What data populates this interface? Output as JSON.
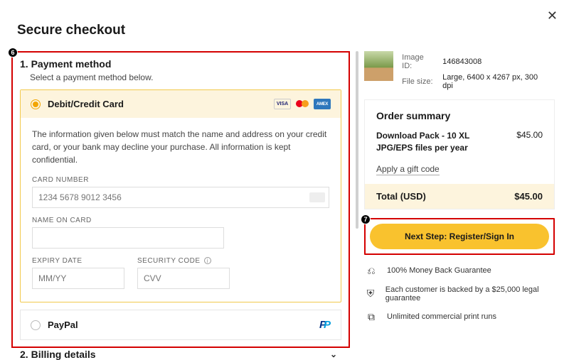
{
  "header": {
    "title": "Secure checkout"
  },
  "close_label": "✕",
  "step_payment": {
    "number": "1.",
    "title": "Payment method",
    "subtitle": "Select a payment method below."
  },
  "card": {
    "label": "Debit/Credit Card",
    "info": "The information given below must match the name and address on your credit card, or your bank may decline your purchase. All information is kept confidential.",
    "fields": {
      "number_label": "CARD NUMBER",
      "number_placeholder": "1234 5678 9012 3456",
      "name_label": "NAME ON CARD",
      "expiry_label": "EXPIRY DATE",
      "expiry_placeholder": "MM/YY",
      "cvv_label": "SECURITY CODE",
      "cvv_placeholder": "CVV"
    },
    "brands": {
      "visa": "VISA",
      "amex": "AMEX"
    }
  },
  "paypal": {
    "label": "PayPal"
  },
  "step_billing": {
    "number": "2.",
    "title": "Billing details"
  },
  "product": {
    "meta": {
      "image_id_label": "Image ID:",
      "image_id": "146843008",
      "size_label": "File size:",
      "size": "Large, 6400 x 4267 px, 300 dpi"
    }
  },
  "order": {
    "title": "Order summary",
    "item_label": "Download Pack - 10 XL JPG/EPS files per year",
    "item_price": "$45.00",
    "gift_label": "Apply a gift code",
    "total_label": "Total (USD)",
    "total_value": "$45.00"
  },
  "next_button": "Next Step: Register/Sign In",
  "benefits": {
    "b1": "100% Money Back Guarantee",
    "b2": "Each customer is backed by a $25,000 legal guarantee",
    "b3": "Unlimited commercial print runs"
  },
  "annotations": {
    "left": "6",
    "right": "7"
  }
}
